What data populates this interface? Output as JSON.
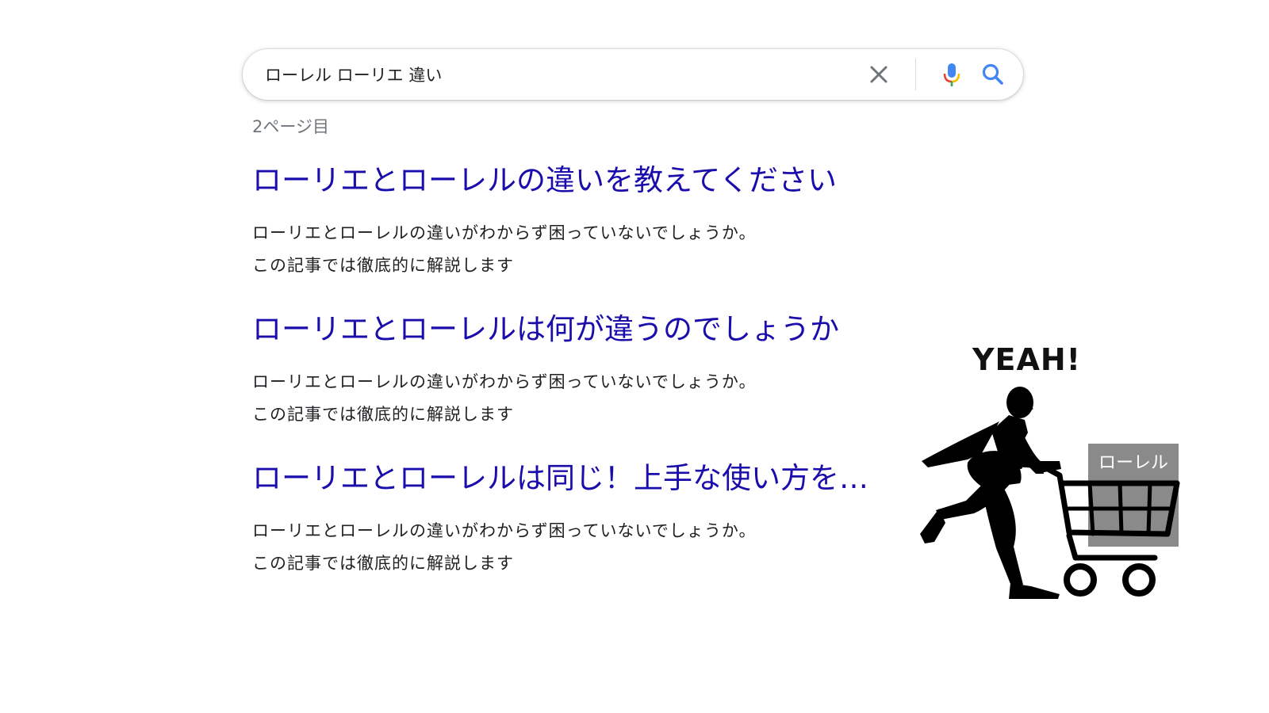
{
  "search": {
    "query": "ローレル ローリエ 違い",
    "clear_icon": "close-icon",
    "mic_icon": "microphone-icon",
    "search_icon": "search-icon"
  },
  "page_label": "2ページ目",
  "results": [
    {
      "title": "ローリエとローレルの違いを教えてください",
      "snippet": "ローリエとローレルの違いがわからず困っていないでしょうか。この記事では徹底的に解説します"
    },
    {
      "title": "ローリエとローレルは何が違うのでしょうか",
      "snippet": "ローリエとローレルの違いがわからず困っていないでしょうか。この記事では徹底的に解説します"
    },
    {
      "title": "ローリエとローレルは同じ！上手な使い方を…",
      "snippet": "ローリエとローレルの違いがわからず困っていないでしょうか。この記事では徹底的に解説します"
    }
  ],
  "illustration": {
    "exclamation": "YEAH!",
    "cart_item_label": "ローレル",
    "figure": "running-man-with-shopping-cart"
  },
  "colors": {
    "link": "#1a0dab",
    "snippet": "#202124",
    "page_label": "#70757a",
    "box": "#8a8a8a"
  }
}
